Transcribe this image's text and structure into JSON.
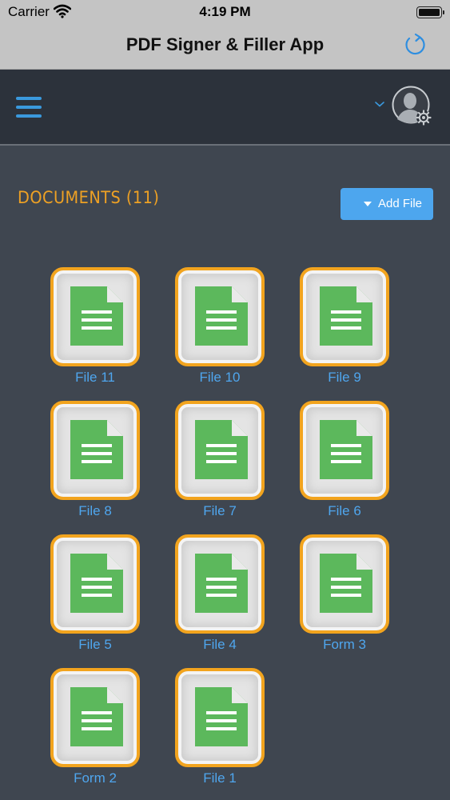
{
  "status_bar": {
    "carrier": "Carrier",
    "time": "4:19 PM"
  },
  "nav": {
    "title": "PDF Signer & Filler App"
  },
  "documents": {
    "heading": "DOCUMENTS (11)",
    "add_button_label": "Add File",
    "files": [
      {
        "name": "File 11"
      },
      {
        "name": "File 10"
      },
      {
        "name": "File 9"
      },
      {
        "name": "File 8"
      },
      {
        "name": "File 7"
      },
      {
        "name": "File 6"
      },
      {
        "name": "File 5"
      },
      {
        "name": "File 4"
      },
      {
        "name": "Form 3"
      },
      {
        "name": "Form 2"
      },
      {
        "name": "File 1"
      }
    ]
  },
  "colors": {
    "accent_blue": "#4da6ee",
    "heading_orange": "#eea124",
    "tile_border": "#f2a41e",
    "document_green": "#5cb85c"
  }
}
